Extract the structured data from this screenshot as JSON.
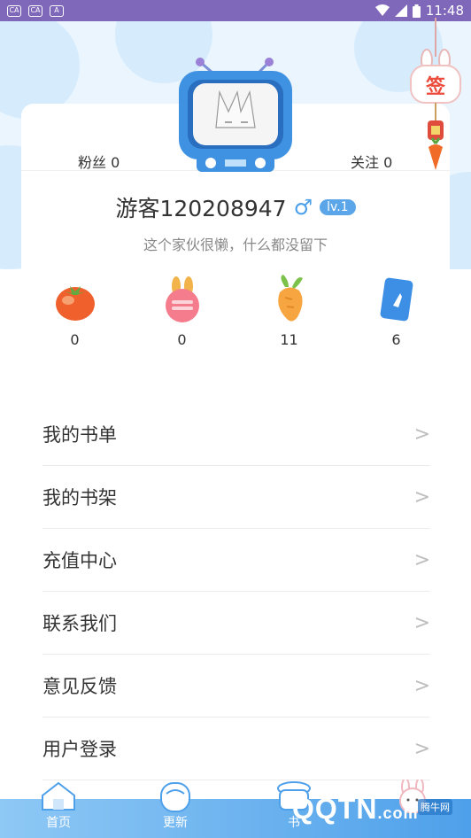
{
  "status_bar": {
    "time": "11:48",
    "left_icons": [
      "CA",
      "CA",
      "A"
    ]
  },
  "profile": {
    "fans": "粉丝 0",
    "follows": "关注 0",
    "username": "游客120208947",
    "gender_symbol": "♂",
    "level": "lv.1",
    "bio": "这个家伙很懒，什么都没留下"
  },
  "sign_in": {
    "label": "签"
  },
  "stats": [
    {
      "icon": "tomato-icon",
      "count": "0"
    },
    {
      "icon": "radish-icon",
      "count": "0"
    },
    {
      "icon": "carrot-icon",
      "count": "11"
    },
    {
      "icon": "card-icon",
      "count": "6"
    }
  ],
  "menu": [
    {
      "label": "我的书单"
    },
    {
      "label": "我的书架"
    },
    {
      "label": "充值中心"
    },
    {
      "label": "联系我们"
    },
    {
      "label": "意见反馈"
    },
    {
      "label": "用户登录"
    }
  ],
  "tabs": [
    {
      "label": "首页",
      "icon": "home-icon"
    },
    {
      "label": "更新",
      "icon": "update-icon"
    },
    {
      "label": "书",
      "icon": "bookshelf-icon"
    },
    {
      "label": "",
      "icon": "bunny-mine-icon"
    }
  ],
  "watermark": {
    "brand": "QQTN",
    "domain": ".com",
    "tag": "腾牛网"
  },
  "colors": {
    "status_bar": "#7f67ba",
    "accent_blue": "#5aa6e8",
    "hero_bg": "#eaf5fe"
  }
}
